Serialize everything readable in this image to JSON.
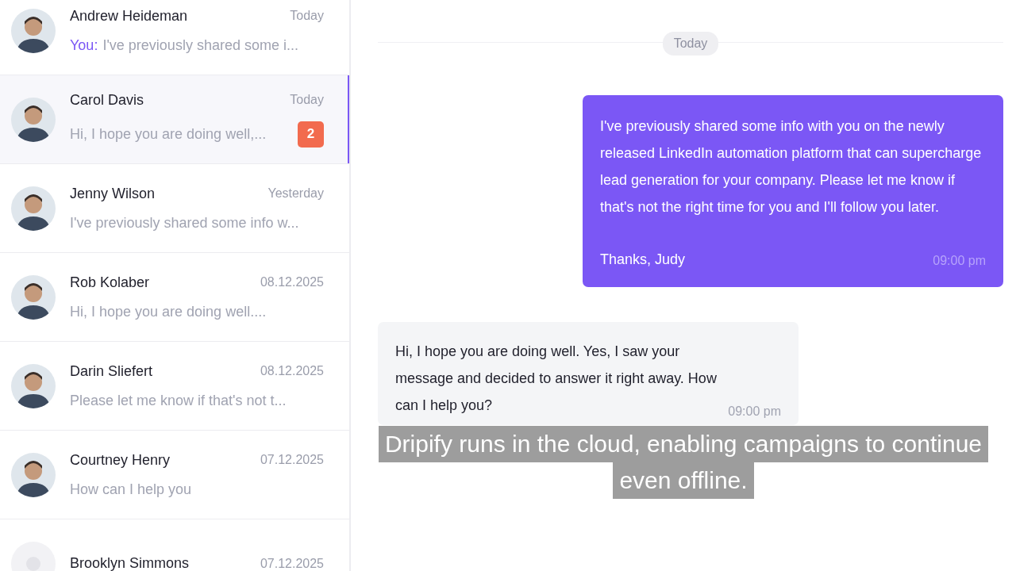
{
  "conversations": [
    {
      "name": "Andrew Heideman",
      "date": "Today",
      "sender": "You:",
      "preview": "I've previously shared some i...",
      "selected": false,
      "placeholder_avatar": false
    },
    {
      "name": "Carol Davis",
      "date": "Today",
      "preview": "Hi, I hope you are doing well,...",
      "unread": "2",
      "selected": true,
      "placeholder_avatar": false
    },
    {
      "name": "Jenny Wilson",
      "date": "Yesterday",
      "preview": "I've previously shared some info w...",
      "selected": false,
      "placeholder_avatar": false
    },
    {
      "name": "Rob Kolaber",
      "date": "08.12.2025",
      "preview": "Hi, I hope you are doing well....",
      "selected": false,
      "placeholder_avatar": false
    },
    {
      "name": "Darin Sliefert",
      "date": "08.12.2025",
      "preview": "Please let me know if that's not t...",
      "selected": false,
      "placeholder_avatar": false
    },
    {
      "name": "Courtney Henry",
      "date": "07.12.2025",
      "preview": "How can I help you",
      "selected": false,
      "placeholder_avatar": false
    },
    {
      "name": "Brooklyn Simmons",
      "date": "07.12.2025",
      "selected": false,
      "placeholder_avatar": true
    }
  ],
  "chat": {
    "day": "Today",
    "messages": [
      {
        "kind": "outgoing",
        "paragraphs": [
          "I've previously shared some info with you on the newly released LinkedIn automation platform that can supercharge lead generation for your company. Please let me know if that's not the right time for you and I'll follow you later.",
          "Thanks, Judy"
        ],
        "time": "09:00 pm"
      },
      {
        "kind": "incoming",
        "paragraphs": [
          "Hi, I hope you are doing well. Yes, I saw your message and decided to answer it right away. How can I help you?"
        ],
        "time": "09:00 pm"
      }
    ]
  },
  "subtitle": [
    "Dripify runs in the cloud, enabling campaigns to continue",
    "even offline."
  ]
}
